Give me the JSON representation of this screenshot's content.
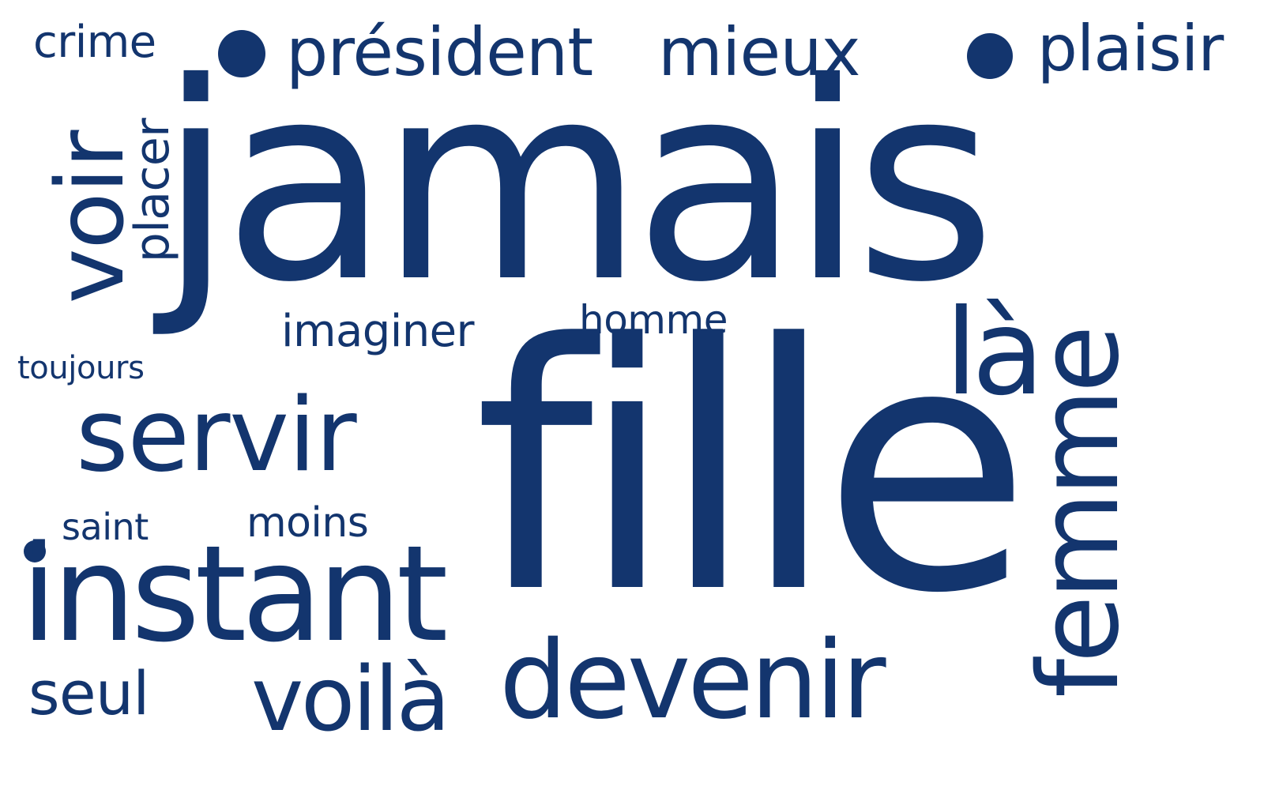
{
  "words": {
    "jamais": "jamais",
    "fille": "fille",
    "president": "président",
    "mieux": "mieux",
    "plaisir": "plaisir",
    "crime": "crime",
    "voir": "voir",
    "placer": "placer",
    "imaginer": "imaginer",
    "homme": "homme",
    "toujours": "toujours",
    "la": "là",
    "femme": "femme",
    "servir": "servir",
    "saint": "saint",
    "moins": "moins",
    "instant": "instant",
    "seul": "seul",
    "voila": "voilà",
    "devenir": "devenir"
  },
  "colors": {
    "text": "#13356e",
    "background": "#ffffff"
  }
}
